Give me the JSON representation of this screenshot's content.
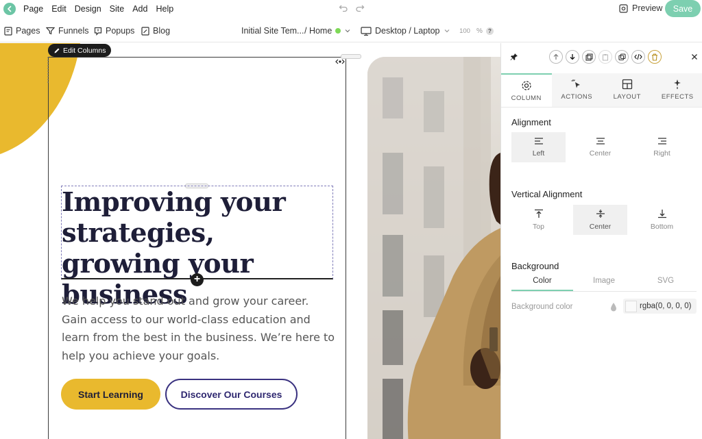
{
  "menubar": {
    "items": [
      "Page",
      "Edit",
      "Design",
      "Site",
      "Add",
      "Help"
    ],
    "preview_label": "Preview",
    "save_label": "Save"
  },
  "toolbar": {
    "pages": "Pages",
    "funnels": "Funnels",
    "popups": "Popups",
    "blog": "Blog",
    "site_name": "Initial Site Tem...",
    "page_name": "/ Home",
    "device": "Desktop / Laptop",
    "zoom": "100",
    "zoom_unit": "%",
    "help": "?"
  },
  "canvas": {
    "edit_columns": "Edit Columns",
    "hero_title": "Improving your strategies, growing your business",
    "hero_body": "We help you stand out and grow your career. Gain access to our world-class education and learn from the best in the business. We’re here to help you achieve your goals.",
    "primary_button": "Start Learning",
    "secondary_button": "Discover Our Courses"
  },
  "panel": {
    "tabs": [
      {
        "label": "COLUMN",
        "icon": "gear-icon"
      },
      {
        "label": "ACTIONS",
        "icon": "cursor-click-icon"
      },
      {
        "label": "LAYOUT",
        "icon": "layout-icon"
      },
      {
        "label": "EFFECTS",
        "icon": "sparkle-icon"
      }
    ],
    "alignment_title": "Alignment",
    "alignment_options": [
      "Left",
      "Center",
      "Right"
    ],
    "alignment_selected": "Left",
    "vertical_title": "Vertical Alignment",
    "vertical_options": [
      "Top",
      "Center",
      "Bottom"
    ],
    "vertical_selected": "Center",
    "background_title": "Background",
    "background_tabs": [
      "Color",
      "Image",
      "SVG"
    ],
    "background_tab_selected": "Color",
    "background_color_label": "Background color",
    "background_color_value": "rgba(0, 0, 0, 0)"
  },
  "colors": {
    "accent": "#7dcfb0",
    "brand_yellow": "#e9b92e",
    "brand_navy": "#2f2870"
  }
}
